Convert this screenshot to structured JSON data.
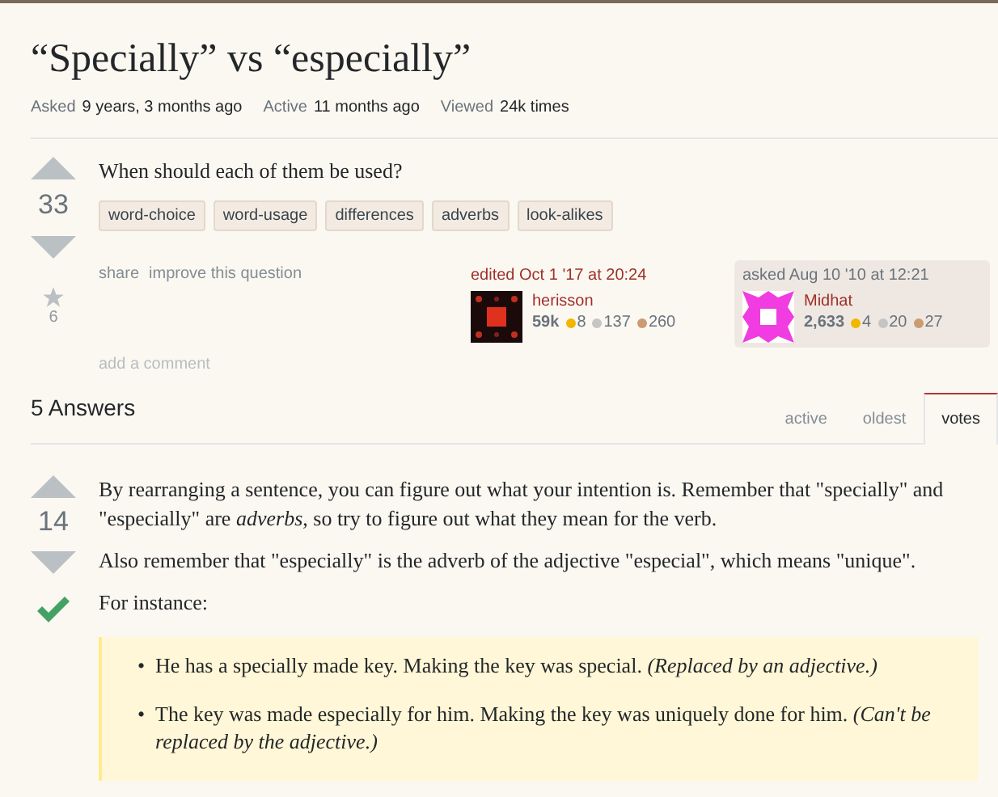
{
  "question": {
    "title": "“Specially” vs “especially”",
    "meta": [
      {
        "label": "Asked",
        "value": "9 years, 3 months ago"
      },
      {
        "label": "Active",
        "value": "11 months ago"
      },
      {
        "label": "Viewed",
        "value": "24k times"
      }
    ],
    "votes": "33",
    "favorites": "6",
    "body": "When should each of them be used?",
    "tags": [
      "word-choice",
      "word-usage",
      "differences",
      "adverbs",
      "look-alikes"
    ],
    "links": [
      "share",
      "improve this question"
    ],
    "cards": [
      {
        "kind": "edited",
        "action": "edited Oct 1 '17 at 20:24",
        "user": "herisson",
        "reputation": "59k",
        "badges": [
          {
            "kind": "gold",
            "count": "8"
          },
          {
            "kind": "silver",
            "count": "137"
          },
          {
            "kind": "bronze",
            "count": "260"
          }
        ]
      },
      {
        "kind": "asked",
        "action": "asked Aug 10 '10 at 12:21",
        "user": "Midhat",
        "reputation": "2,633",
        "badges": [
          {
            "kind": "gold",
            "count": "4"
          },
          {
            "kind": "silver",
            "count": "20"
          },
          {
            "kind": "bronze",
            "count": "27"
          }
        ]
      }
    ],
    "add_comment": "add a comment"
  },
  "answers_header": {
    "count": "5 Answers",
    "tabs": [
      {
        "label": "active",
        "selected": false
      },
      {
        "label": "oldest",
        "selected": false
      },
      {
        "label": "votes",
        "selected": true
      }
    ]
  },
  "answer": {
    "votes": "14",
    "accepted": true,
    "paragraphs": [
      "By rearranging a sentence, you can figure out what your intention is. Remember that \"specially\" and \"especially\" are *adverbs*, so try to figure out what they mean for the verb.",
      "Also remember that \"especially\" is the adverb of the adjective \"especial\", which means \"unique\".",
      "For instance:"
    ],
    "quote_items": [
      {
        "bullet": "•",
        "text": "He has a specially made key. Making the key was special. *(Replaced by an adjective.)*"
      },
      {
        "bullet": "•",
        "text": "The key was made especially for him. Making the key was uniquely done for him. *(Can't be replaced by the adjective.)*"
      }
    ]
  }
}
